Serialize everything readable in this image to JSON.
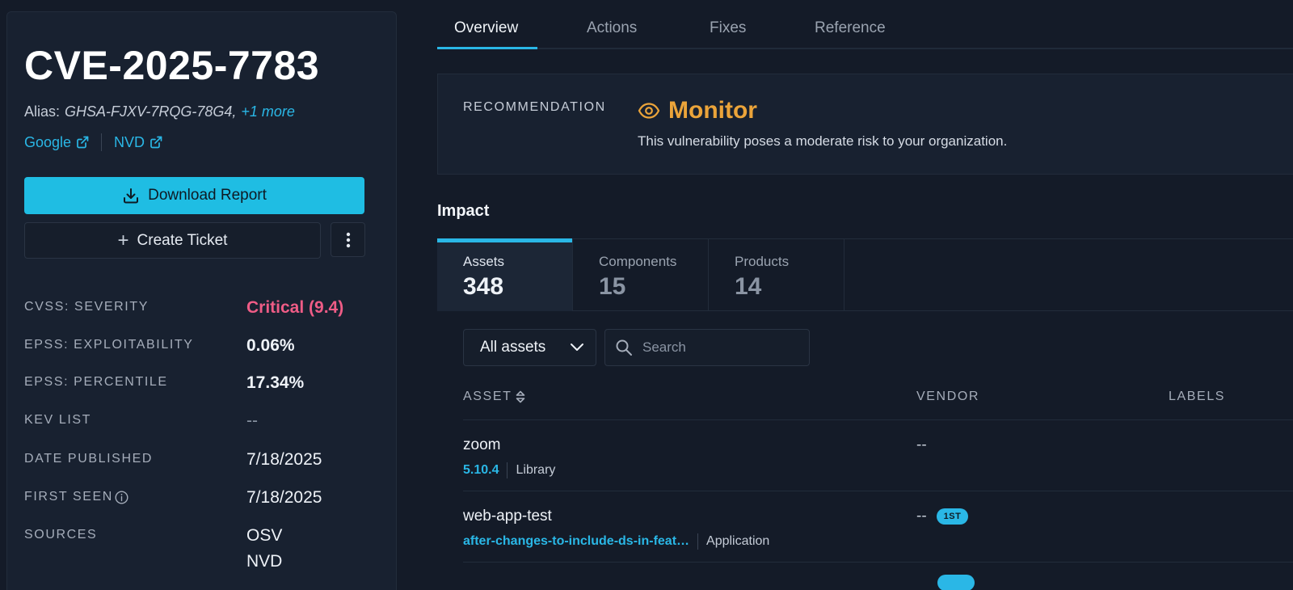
{
  "sidebar": {
    "cve_id": "CVE-2025-7783",
    "alias_label": "Alias:",
    "alias_value": "GHSA-FJXV-7RQG-78G4,",
    "alias_more": "+1 more",
    "links": [
      {
        "label": "Google",
        "icon": "external-link-icon"
      },
      {
        "label": "NVD",
        "icon": "external-link-icon"
      }
    ],
    "download_label": "Download Report",
    "ticket_label": "Create Ticket",
    "details": {
      "cvss_label": "CVSS: SEVERITY",
      "cvss_value": "Critical (9.4)",
      "epss_exploit_label": "EPSS: EXPLOITABILITY",
      "epss_exploit_value": "0.06%",
      "epss_percentile_label": "EPSS: PERCENTILE",
      "epss_percentile_value": "17.34%",
      "kev_label": "KEV LIST",
      "kev_value": "--",
      "published_label": "DATE PUBLISHED",
      "published_value": "7/18/2025",
      "first_seen_label": "FIRST SEEN",
      "first_seen_value": "7/18/2025",
      "sources_label": "SOURCES",
      "sources": [
        "OSV",
        "NVD"
      ]
    }
  },
  "tabs": [
    "Overview",
    "Actions",
    "Fixes",
    "Reference"
  ],
  "recommendation": {
    "label": "RECOMMENDATION",
    "value": "Monitor",
    "description": "This vulnerability poses a moderate risk to your organization.",
    "color": "#eba43a"
  },
  "impact": {
    "title": "Impact",
    "stats": [
      {
        "label": "Assets",
        "count": "348"
      },
      {
        "label": "Components",
        "count": "15"
      },
      {
        "label": "Products",
        "count": "14"
      }
    ],
    "filter_value": "All assets",
    "search_placeholder": "Search",
    "columns": [
      "ASSET",
      "VENDOR",
      "LABELS"
    ],
    "rows": [
      {
        "name": "zoom",
        "version": "5.10.4",
        "type": "Library",
        "vendor": "--",
        "badge": ""
      },
      {
        "name": "web-app-test",
        "version": "after-changes-to-include-ds-in-feat…",
        "type": "Application",
        "vendor": "--",
        "badge": "1ST"
      }
    ]
  },
  "colors": {
    "accent": "#2ab7e6",
    "critical": "#ef5c86",
    "monitor": "#eba43a"
  }
}
